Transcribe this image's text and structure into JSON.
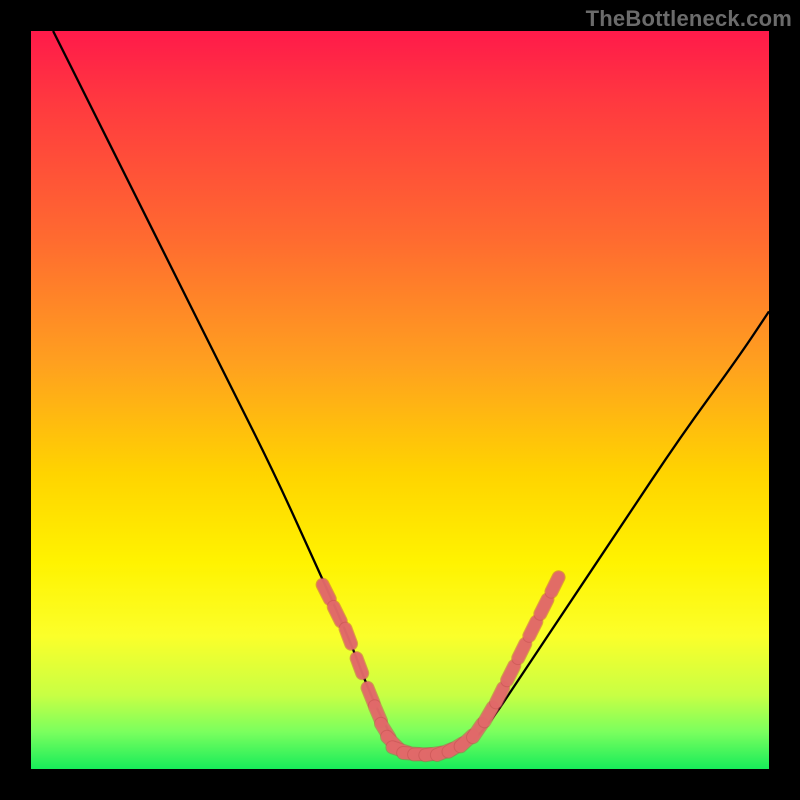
{
  "watermark": "TheBottleneck.com",
  "colors": {
    "frame": "#000000",
    "curve": "#000000",
    "marker_fill": "#e26a6a",
    "marker_stroke": "#c24f4f"
  },
  "chart_data": {
    "type": "line",
    "title": "",
    "xlabel": "",
    "ylabel": "",
    "xlim": [
      0,
      100
    ],
    "ylim": [
      0,
      100
    ],
    "grid": false,
    "legend": false,
    "note": "No axis ticks or numeric labels are rendered; values below are positional estimates in percent of plot area (x left→right, y bottom→top).",
    "series": [
      {
        "name": "bottleneck-curve",
        "x": [
          3,
          8,
          13,
          20,
          27,
          33,
          38,
          43,
          46,
          48.5,
          50,
          53,
          56,
          59,
          62,
          66,
          72,
          80,
          88,
          96,
          100
        ],
        "y": [
          100,
          90,
          80,
          66,
          52,
          40,
          29,
          18,
          10,
          5,
          2.5,
          2,
          2.2,
          3,
          6,
          12,
          21,
          33,
          45,
          56,
          62
        ]
      }
    ],
    "markers": {
      "name": "highlight-dots",
      "note": "Short coral dot/segment clusters on the curve near the valley",
      "points": [
        {
          "x": 40,
          "y": 24
        },
        {
          "x": 41.5,
          "y": 21
        },
        {
          "x": 43,
          "y": 18
        },
        {
          "x": 44.5,
          "y": 14
        },
        {
          "x": 46,
          "y": 10
        },
        {
          "x": 47,
          "y": 7.5
        },
        {
          "x": 48,
          "y": 5.2
        },
        {
          "x": 49,
          "y": 3.6
        },
        {
          "x": 50,
          "y": 2.6
        },
        {
          "x": 51.5,
          "y": 2.1
        },
        {
          "x": 53,
          "y": 2.0
        },
        {
          "x": 54.5,
          "y": 2.05
        },
        {
          "x": 56,
          "y": 2.3
        },
        {
          "x": 57.5,
          "y": 2.9
        },
        {
          "x": 59,
          "y": 3.8
        },
        {
          "x": 60.5,
          "y": 5.2
        },
        {
          "x": 62,
          "y": 7.4
        },
        {
          "x": 63.5,
          "y": 10
        },
        {
          "x": 65,
          "y": 13
        },
        {
          "x": 66.5,
          "y": 16
        },
        {
          "x": 68,
          "y": 19
        },
        {
          "x": 69.5,
          "y": 22
        },
        {
          "x": 71,
          "y": 25
        }
      ]
    }
  }
}
